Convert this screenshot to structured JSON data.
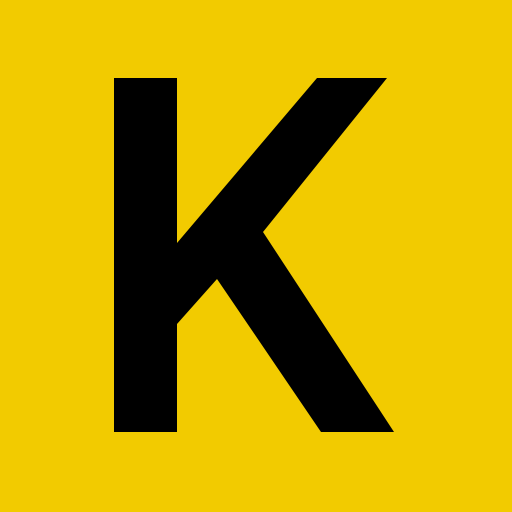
{
  "logo": {
    "letter": "K",
    "background_color": "#F2CB00",
    "letter_color": "#000000"
  }
}
